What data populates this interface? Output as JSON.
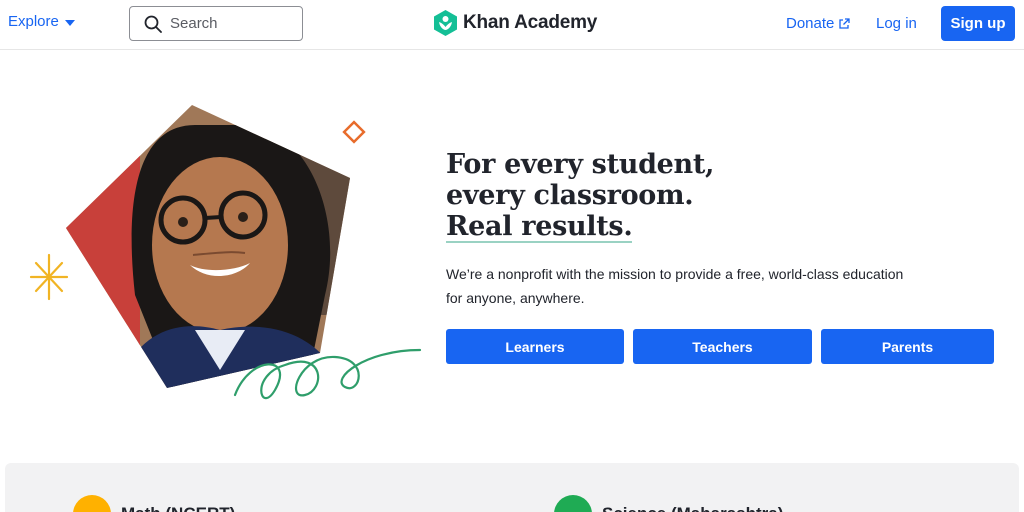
{
  "header": {
    "explore_label": "Explore",
    "search_placeholder": "Search",
    "logo_text": "Khan Academy",
    "donate_label": "Donate",
    "login_label": "Log in",
    "signup_label": "Sign up"
  },
  "hero": {
    "headline_line1": "For every student,",
    "headline_line2": "every classroom.",
    "headline_line3": "Real results.",
    "subtitle": "We’re a nonprofit with the mission to provide a free, world-class education for anyone, anywhere.",
    "buttons": [
      {
        "label": "Learners"
      },
      {
        "label": "Teachers"
      },
      {
        "label": "Parents"
      }
    ]
  },
  "courses": [
    {
      "name": "Math (NCERT)",
      "icon": "math-icon",
      "color": "#ffb100"
    },
    {
      "name": "Science (Maharashtra)",
      "icon": "science-icon",
      "color": "#1fab54"
    }
  ],
  "colors": {
    "brand_blue": "#1865f2",
    "logo_green": "#14bf96",
    "text": "#21242c"
  }
}
